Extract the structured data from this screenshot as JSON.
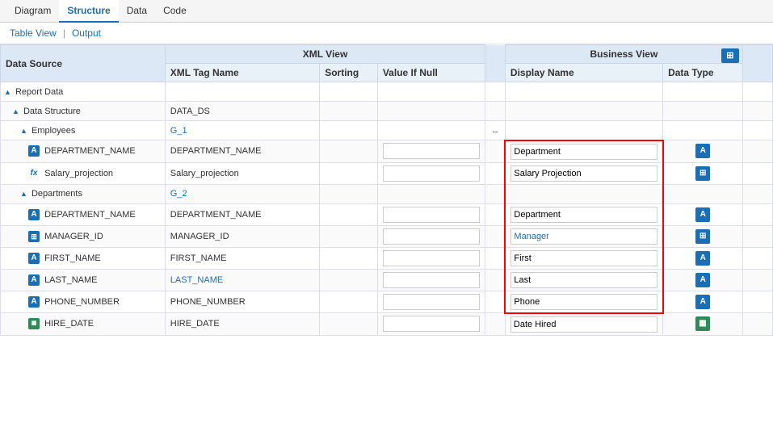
{
  "tabs": {
    "top": [
      {
        "label": "Diagram",
        "active": false
      },
      {
        "label": "Structure",
        "active": true
      },
      {
        "label": "Data",
        "active": false
      },
      {
        "label": "Code",
        "active": false
      }
    ],
    "sub": [
      {
        "label": "Table View"
      },
      {
        "separator": "|"
      },
      {
        "label": "Output"
      }
    ]
  },
  "table": {
    "group_headers": {
      "xml_view": "XML View",
      "business_view": "Business View"
    },
    "col_headers": {
      "data_source": "Data Source",
      "xml_tag_name": "XML Tag Name",
      "sorting": "Sorting",
      "value_if_null": "Value If Null",
      "display_name": "Display Name",
      "data_type": "Data Type"
    },
    "rows": [
      {
        "type": "group",
        "indent": 0,
        "label": "Report Data",
        "tri": "▲",
        "xml_tag": "",
        "sorting": "",
        "value_null": "",
        "display_name": "",
        "data_type": "",
        "icon": ""
      },
      {
        "type": "group",
        "indent": 1,
        "label": "Data Structure",
        "tri": "▲",
        "xml_tag": "DATA_DS",
        "xml_blue": false,
        "sorting": "",
        "value_null": "",
        "display_name": "",
        "data_type": "",
        "icon": ""
      },
      {
        "type": "group",
        "indent": 2,
        "label": "Employees",
        "tri": "▲",
        "xml_tag": "G_1",
        "xml_blue": true,
        "sorting": "",
        "value_null": "",
        "display_name": "",
        "data_type": "",
        "icon": ""
      },
      {
        "type": "field",
        "indent": 3,
        "icon_type": "a",
        "label": "DEPARTMENT_NAME",
        "xml_tag": "DEPARTMENT_NAME",
        "xml_blue": false,
        "sorting": "",
        "value_null": "",
        "display_name": "Department",
        "data_type": "a",
        "red": "top-left-right"
      },
      {
        "type": "field",
        "indent": 3,
        "icon_type": "fx",
        "label": "Salary_projection",
        "xml_tag": "Salary_projection",
        "xml_blue": false,
        "sorting": "",
        "value_null": "",
        "display_name": "Salary Projection",
        "data_type": "hash",
        "red": "left-right"
      },
      {
        "type": "group",
        "indent": 2,
        "label": "Departments",
        "tri": "▲",
        "xml_tag": "G_2",
        "xml_blue": true,
        "sorting": "",
        "value_null": "",
        "display_name": "",
        "data_type": "",
        "icon": "",
        "red": "left-right"
      },
      {
        "type": "field",
        "indent": 3,
        "icon_type": "a",
        "label": "DEPARTMENT_NAME",
        "xml_tag": "DEPARTMENT_NAME",
        "xml_blue": false,
        "sorting": "",
        "value_null": "",
        "display_name": "Department",
        "data_type": "a",
        "red": "left-right"
      },
      {
        "type": "field",
        "indent": 3,
        "icon_type": "hash",
        "label": "MANAGER_ID",
        "xml_tag": "MANAGER_ID",
        "xml_blue": false,
        "sorting": "",
        "value_null": "",
        "display_name": "Manager",
        "data_type": "hash",
        "red": "left-right"
      },
      {
        "type": "field",
        "indent": 3,
        "icon_type": "a",
        "label": "FIRST_NAME",
        "xml_tag": "FIRST_NAME",
        "xml_blue": false,
        "sorting": "",
        "value_null": "",
        "display_name": "First",
        "data_type": "a",
        "red": "left-right"
      },
      {
        "type": "field",
        "indent": 3,
        "icon_type": "a",
        "label": "LAST_NAME",
        "xml_tag": "LAST_NAME",
        "xml_blue": true,
        "sorting": "",
        "value_null": "",
        "display_name": "Last",
        "data_type": "a",
        "red": "left-right"
      },
      {
        "type": "field",
        "indent": 3,
        "icon_type": "a",
        "label": "PHONE_NUMBER",
        "xml_tag": "PHONE_NUMBER",
        "xml_blue": false,
        "sorting": "",
        "value_null": "",
        "display_name": "Phone",
        "data_type": "a",
        "red": "bottom-left-right"
      },
      {
        "type": "field",
        "indent": 3,
        "icon_type": "date",
        "label": "HIRE_DATE",
        "xml_tag": "HIRE_DATE",
        "xml_blue": false,
        "sorting": "",
        "value_null": "",
        "display_name": "Date Hired",
        "data_type": "date",
        "red": ""
      }
    ]
  },
  "icons": {
    "resize": "↔",
    "bv_button": "≡",
    "tri_collapse": "▲"
  }
}
